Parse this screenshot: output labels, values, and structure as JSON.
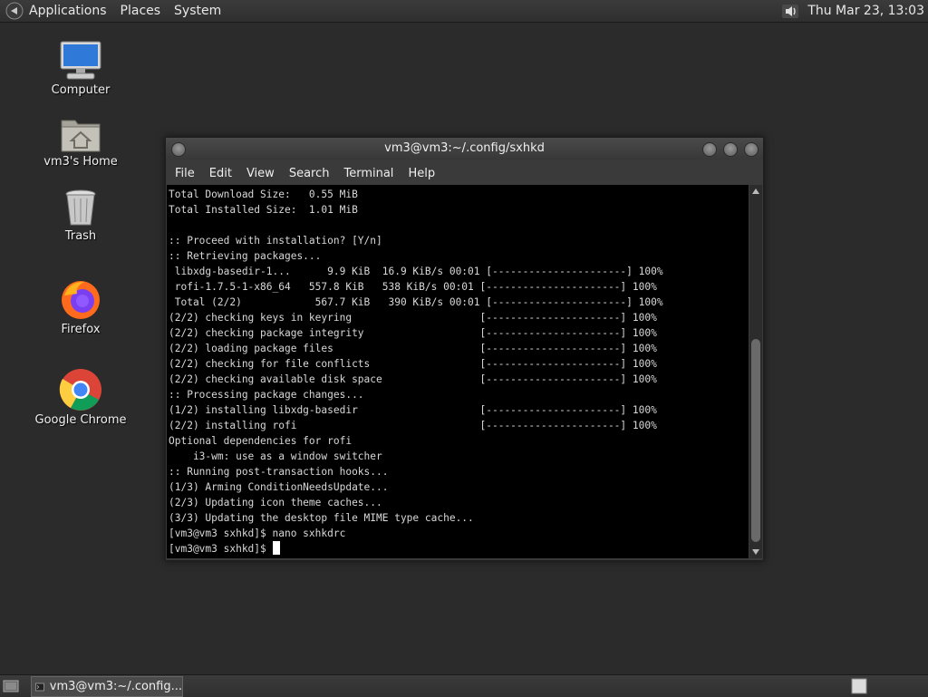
{
  "top_panel": {
    "menus": [
      "Applications",
      "Places",
      "System"
    ],
    "clock": "Thu Mar 23, 13:03"
  },
  "desktop": {
    "icons": [
      {
        "label": "Computer",
        "icon": "computer-icon"
      },
      {
        "label": "vm3's Home",
        "icon": "home-folder-icon"
      },
      {
        "label": "Trash",
        "icon": "trash-icon"
      },
      {
        "label": "Firefox",
        "icon": "firefox-icon"
      },
      {
        "label": "Google Chrome",
        "icon": "chrome-icon"
      }
    ]
  },
  "terminal": {
    "title": "vm3@vm3:~/.config/sxhkd",
    "menu": [
      "File",
      "Edit",
      "View",
      "Search",
      "Terminal",
      "Help"
    ],
    "lines": [
      "Total Download Size:   0.55 MiB",
      "Total Installed Size:  1.01 MiB",
      "",
      ":: Proceed with installation? [Y/n]",
      ":: Retrieving packages...",
      " libxdg-basedir-1...      9.9 KiB  16.9 KiB/s 00:01 [----------------------] 100%",
      " rofi-1.7.5-1-x86_64   557.8 KiB   538 KiB/s 00:01 [----------------------] 100%",
      " Total (2/2)            567.7 KiB   390 KiB/s 00:01 [----------------------] 100%",
      "(2/2) checking keys in keyring                     [----------------------] 100%",
      "(2/2) checking package integrity                   [----------------------] 100%",
      "(2/2) loading package files                        [----------------------] 100%",
      "(2/2) checking for file conflicts                  [----------------------] 100%",
      "(2/2) checking available disk space                [----------------------] 100%",
      ":: Processing package changes...",
      "(1/2) installing libxdg-basedir                    [----------------------] 100%",
      "(2/2) installing rofi                              [----------------------] 100%",
      "Optional dependencies for rofi",
      "    i3-wm: use as a window switcher",
      ":: Running post-transaction hooks...",
      "(1/3) Arming ConditionNeedsUpdate...",
      "(2/3) Updating icon theme caches...",
      "(3/3) Updating the desktop file MIME type cache...",
      "[vm3@vm3 sxhkd]$ nano sxhkdrc"
    ],
    "prompt": "[vm3@vm3 sxhkd]$ "
  },
  "bottom_panel": {
    "task_label": "vm3@vm3:~/.config..."
  }
}
